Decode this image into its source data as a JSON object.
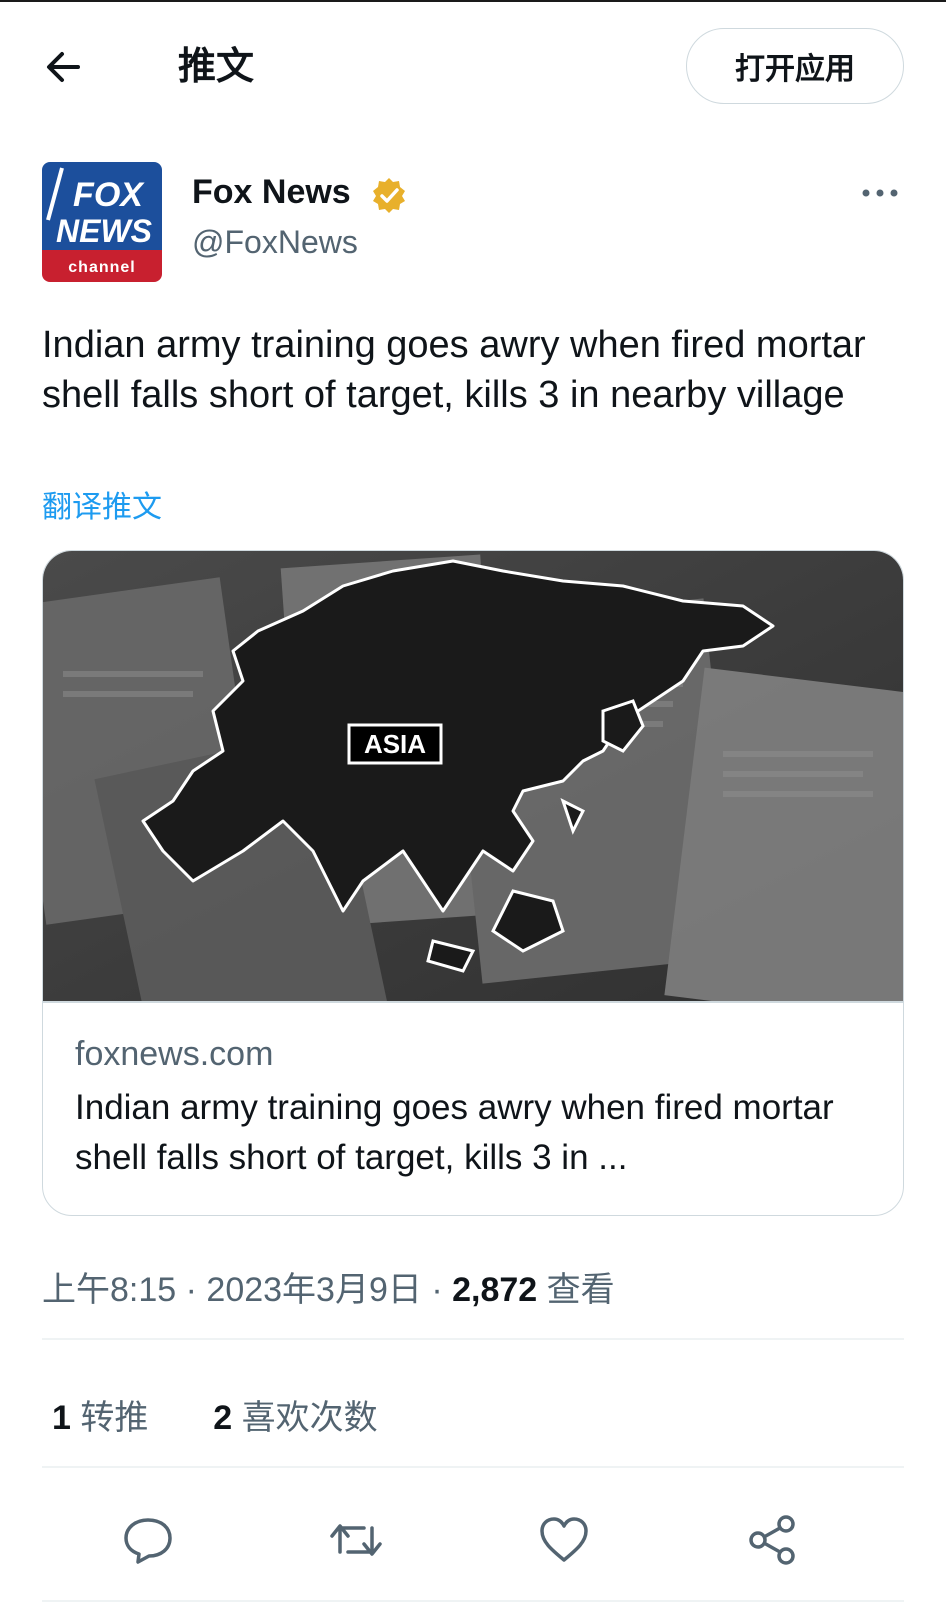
{
  "header": {
    "title": "推文",
    "open_app_label": "打开应用"
  },
  "author": {
    "name": "Fox News",
    "handle": "@FoxNews",
    "verified": true,
    "avatar_logo_lines": [
      "FOX",
      "NEWS",
      "channel"
    ]
  },
  "tweet": {
    "text": "Indian army training goes awry when fired mortar shell falls short of target, kills 3 in nearby village",
    "translate_label": "翻译推文"
  },
  "card": {
    "image_map_label": "ASIA",
    "domain": "foxnews.com",
    "title": "Indian army training goes awry when fired mortar shell falls short of target, kills 3 in ..."
  },
  "meta": {
    "time": "上午8:15",
    "separator": "·",
    "date": "2023年3月9日",
    "views_count": "2,872",
    "views_label": "查看"
  },
  "stats": {
    "retweets_count": "1",
    "retweets_label": "转推",
    "likes_count": "2",
    "likes_label": "喜欢次数"
  },
  "icons": [
    "back-arrow-icon",
    "verified-badge-icon",
    "more-icon",
    "reply-icon",
    "retweet-icon",
    "like-icon",
    "share-icon"
  ],
  "colors": {
    "accent": "#1d9bf0",
    "verified": "#e8b02b",
    "text": "#0f1419",
    "secondary": "#536471"
  }
}
